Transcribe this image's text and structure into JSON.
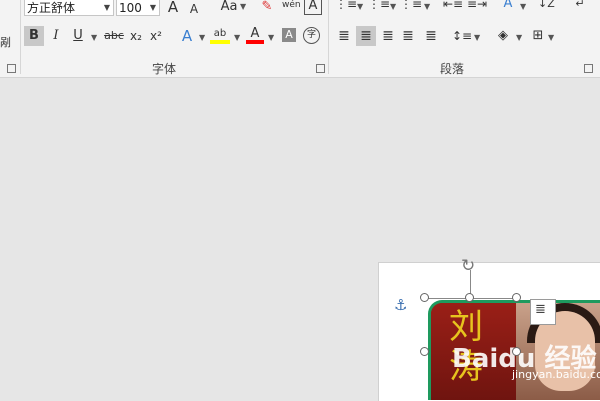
{
  "clipboard": {
    "cut_label_fragment": "剐"
  },
  "font": {
    "family_value": "方正舒体",
    "size_value": "100",
    "grow_icon_label": "A",
    "shrink_icon_label": "A",
    "case_label": "Aa",
    "clear_format_label": "✎",
    "phonetic_label": "wén",
    "border_char_label": "A",
    "bold_label": "B",
    "italic_label": "I",
    "underline_label": "U",
    "strike_label": "abc",
    "sub_label": "x₂",
    "sup_label": "x²",
    "text_effect_label": "A",
    "highlight_label": "ab",
    "font_color_label": "A",
    "char_shading_label": "A",
    "enclose_label": "字",
    "group_label": "字体"
  },
  "paragraph": {
    "group_label": "段落"
  },
  "document": {
    "image_watermark": "Baidu 经验",
    "image_watermark_url": "jingyan.baidu.com",
    "calligraphy_text": "刘涛"
  },
  "colors": {
    "accent_green": "#1e9a5e",
    "highlight_yellow": "#ffff00",
    "font_red": "#ff0000"
  }
}
